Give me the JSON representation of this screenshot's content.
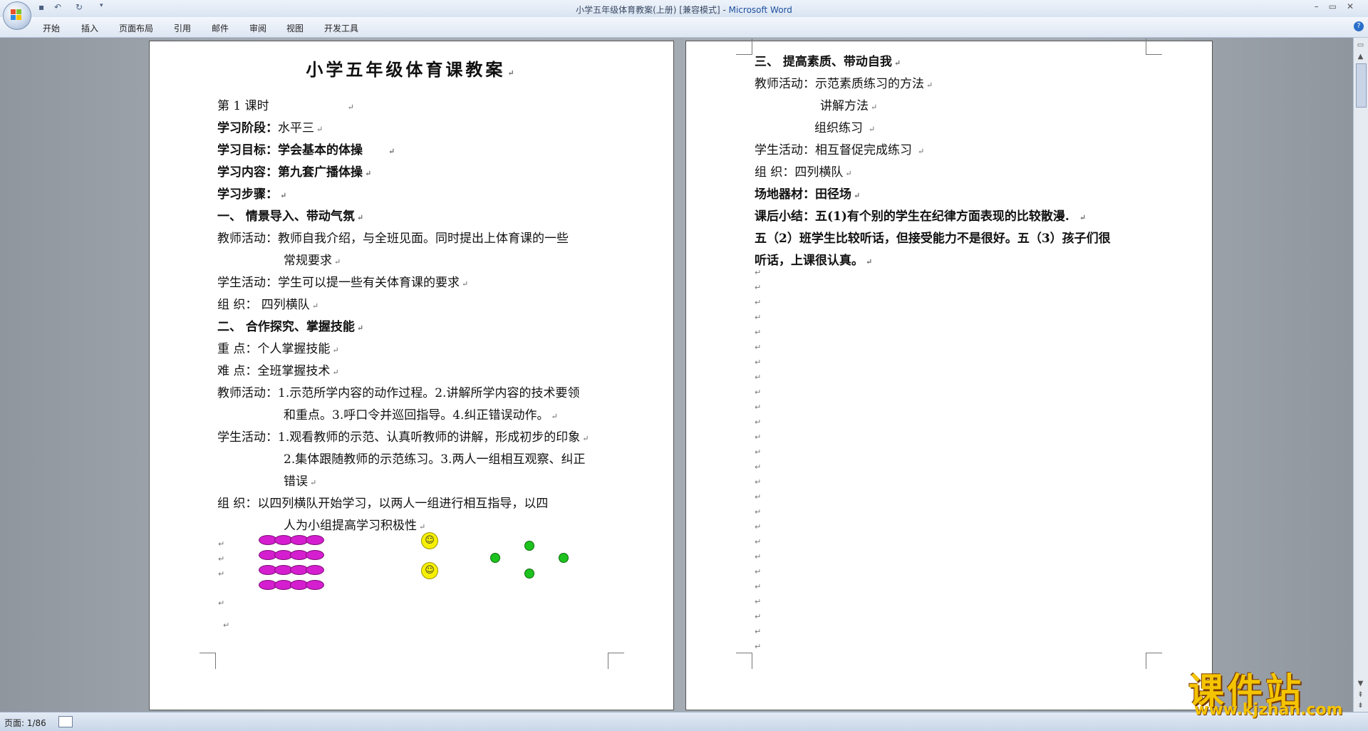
{
  "window": {
    "title": "小学五年级体育教案(上册) [兼容模式]",
    "title_sep": " - ",
    "app_name": "Microsoft Word"
  },
  "ribbon_tabs": [
    "开始",
    "插入",
    "页面布局",
    "引用",
    "邮件",
    "审阅",
    "视图",
    "开发工具"
  ],
  "status": {
    "page": "页面: 1/86"
  },
  "watermark": {
    "title": "课件站",
    "url": "www.kjzhan.com"
  },
  "page1": {
    "title": "小学五年级体育课教案",
    "lines": [
      "第 1 课时",
      "学习阶段：",
      "水平三",
      "学习目标：学会基本的体操",
      "学习内容：第九套广播体操",
      "学习步骤：",
      "一、    情景导入、带动气氛",
      "教师活动：教师自我介绍，与全班见面。同时提出上体育课的一些",
      "常规要求",
      "学生活动：学生可以提一些有关体育课的要求",
      "组      织：   四列横队",
      "二、    合作探究、掌握技能",
      "重      点：个人掌握技能",
      "难      点：全班掌握技术",
      "教师活动：1.示范所学内容的动作过程。2.讲解所学内容的技术要领",
      "和重点。3.呼口令并巡回指导。4.纠正错误动作。",
      "学生活动：1.观看教师的示范、认真听教师的讲解，形成初步的印象",
      "2.集体跟随教师的示范练习。3.两人一组相互观察、纠正",
      "错误",
      "组        织：以四列横队开始学习，以两人一组进行相互指导，以四",
      "人为小组提高学习积极性"
    ]
  },
  "page2": {
    "lines": [
      "三、    提高素质、带动自我",
      "教师活动：示范素质练习的方法",
      "讲解方法",
      "组织练习",
      "学生活动：相互督促完成练习",
      "组      织：四列横队",
      "场地器材：田径场",
      "课后小结：五(1)有个别的学生在纪律方面表现的比较散漫.",
      "五（2）班学生比较听话，但接受能力不是很好。五（3）孩子们很",
      "听话，上课很认真。"
    ]
  },
  "colors": {
    "accent": "#1d4f9e",
    "magenta": "#d51ecf",
    "smiley_yellow": "#f6f000",
    "smiley_green": "#1ec21e",
    "watermark": "#f4c400"
  }
}
